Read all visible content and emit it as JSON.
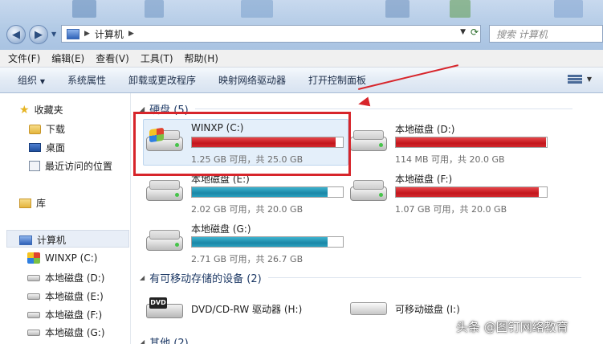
{
  "address": {
    "location": "计算机"
  },
  "search": {
    "placeholder": "搜索 计算机"
  },
  "menu": [
    "文件(F)",
    "编辑(E)",
    "查看(V)",
    "工具(T)",
    "帮助(H)"
  ],
  "toolbar": [
    "组织",
    "系统属性",
    "卸载或更改程序",
    "映射网络驱动器",
    "打开控制面板"
  ],
  "sidebar": {
    "favorites": {
      "label": "收藏夹",
      "items": [
        "下载",
        "桌面",
        "最近访问的位置"
      ]
    },
    "library": "库",
    "computer": {
      "label": "计算机",
      "items": [
        "WINXP (C:)",
        "本地磁盘 (D:)",
        "本地磁盘 (E:)",
        "本地磁盘 (F:)",
        "本地磁盘 (G:)"
      ]
    }
  },
  "groups": {
    "hdd": "硬盘 (5)",
    "removable": "有可移动存储的设备 (2)",
    "other": "其他 (2)"
  },
  "drives": [
    {
      "name": "WINXP (C:)",
      "size": "1.25 GB 可用，共 25.0 GB",
      "used_fraction": 0.95,
      "color": "#c3161c"
    },
    {
      "name": "本地磁盘 (D:)",
      "size": "114 MB 可用，共 20.0 GB",
      "used_fraction": 0.994,
      "color": "#c3161c"
    },
    {
      "name": "本地磁盘 (E:)",
      "size": "2.02 GB 可用，共 20.0 GB",
      "used_fraction": 0.9,
      "color": "#1b87a7"
    },
    {
      "name": "本地磁盘 (F:)",
      "size": "1.07 GB 可用，共 20.0 GB",
      "used_fraction": 0.947,
      "color": "#c3161c"
    },
    {
      "name": "本地磁盘 (G:)",
      "size": "2.71 GB 可用，共 26.7 GB",
      "used_fraction": 0.9,
      "color": "#1b87a7"
    }
  ],
  "devices": [
    {
      "name": "DVD/CD-RW 驱动器 (H:)",
      "badge": "DVD"
    },
    {
      "name": "可移动磁盘 (I:)"
    }
  ],
  "watermark": "头条 @图钉网络教育"
}
